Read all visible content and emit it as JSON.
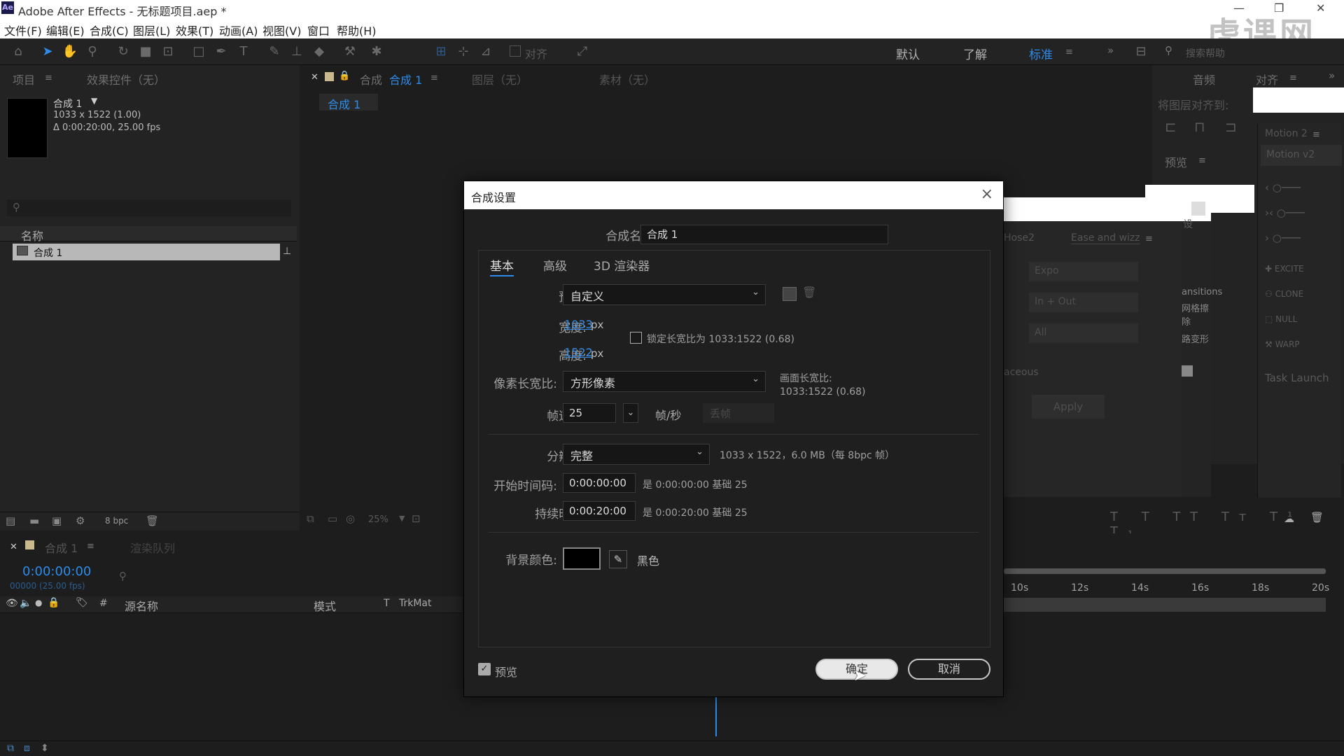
{
  "app": {
    "title": "Adobe After Effects - 无标题项目.aep *",
    "logo": "Ae"
  },
  "menu": [
    "文件(F)",
    "编辑(E)",
    "合成(C)",
    "图层(L)",
    "效果(T)",
    "动画(A)",
    "视图(V)",
    "窗口",
    "帮助(H)"
  ],
  "watermark": "虎课网",
  "toolbar": {
    "align_label": "对齐",
    "workspaces": [
      "默认",
      "了解",
      "标准"
    ],
    "search_placeholder": "搜索帮助"
  },
  "project_panel": {
    "tab_project": "项目",
    "tab_effects": "效果控件（无）",
    "comp_name": "合成 1",
    "comp_info1": "1033 x 1522 (1.00)",
    "comp_info2": "Δ 0:00:20:00, 25.00 fps",
    "col_name": "名称",
    "item": "合成 1",
    "bpc": "8 bpc"
  },
  "comp_panel": {
    "tab": "合成",
    "tab_name": "合成 1",
    "layer_tab": "图层（无）",
    "footage_tab": "素材（无）",
    "breadcrumb": "合成 1",
    "zoom": "25%"
  },
  "right_panels": {
    "audio": "音频",
    "align": "对齐",
    "align_to": "将图层对齐到:",
    "preview": "预览",
    "motion2": "Motion 2",
    "motion_v2": "Motion v2",
    "excite": "EXCITE",
    "clone": "CLONE",
    "null": "NULL",
    "warp": "WARP",
    "task_launch": "Task Launch",
    "hose": "Hose2",
    "ease": "Ease and wizz",
    "expo": "Expo",
    "in_out": "In + Out",
    "all": "All",
    "apply": "Apply",
    "transitions": "ansitions",
    "grid_erase": "网格擦除",
    "deform": "路变形",
    "aceous": "aceous",
    "setting": "设"
  },
  "timeline": {
    "tab": "合成 1",
    "render_queue": "渲染队列",
    "timecode": "0:00:00:00",
    "frames": "00000 (25.00 fps)",
    "cols": {
      "num": "#",
      "source": "源名称",
      "mode": "模式",
      "t": "T",
      "trkmat": "TrkMat"
    },
    "ruler": [
      "10s",
      "12s",
      "14s",
      "16s",
      "18s",
      "20s"
    ]
  },
  "dialog": {
    "title": "合成设置",
    "name_label": "合成名称:",
    "name_value": "合成 1",
    "tabs": [
      "基本",
      "高级",
      "3D 渲染器"
    ],
    "preset_label": "预设:",
    "preset_value": "自定义",
    "width_label": "宽度:",
    "width_value": "1033",
    "px": "px",
    "height_label": "高度:",
    "height_value": "1522",
    "lock_label": "锁定长宽比为 1033:1522 (0.68)",
    "par_label": "像素长宽比:",
    "par_value": "方形像素",
    "frame_aspect_label": "画面长宽比:",
    "frame_aspect_value": "1033:1522 (0.68)",
    "fps_label": "帧速率:",
    "fps_value": "25",
    "fps_unit": "帧/秒",
    "drop_frame": "丢帧",
    "res_label": "分辨率:",
    "res_value": "完整",
    "res_info": "1033 x 1522，6.0 MB（每 8bpc 帧）",
    "start_label": "开始时间码:",
    "start_value": "0:00:00:00",
    "start_info": "是 0:00:00:00  基础 25",
    "dur_label": "持续时间:",
    "dur_value": "0:00:20:00",
    "dur_info": "是 0:00:20:00  基础 25",
    "bg_label": "背景颜色:",
    "bg_color_name": "黑色",
    "preview_label": "预览",
    "ok": "确定",
    "cancel": "取消"
  },
  "colors": {
    "accent": "#2d8ceb",
    "bg_swatch": "#000000"
  }
}
